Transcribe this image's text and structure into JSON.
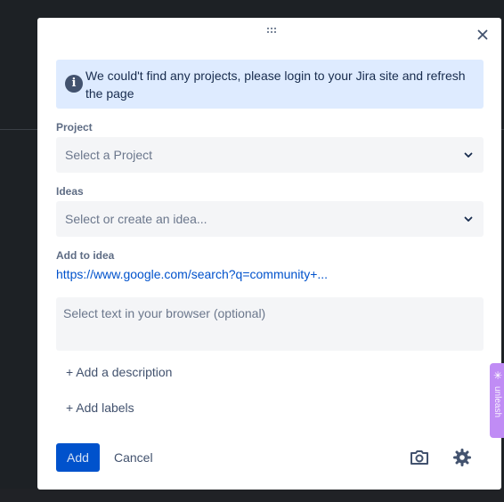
{
  "banner": {
    "icon": "info-icon",
    "text": "We could't find any projects, please login to your Jira site and refresh the page"
  },
  "fields": {
    "project": {
      "label": "Project",
      "placeholder": "Select a Project"
    },
    "ideas": {
      "label": "Ideas",
      "placeholder": "Select or create an idea..."
    },
    "add_to_idea": {
      "label": "Add to idea",
      "link": "https://www.google.com/search?q=community+..."
    },
    "selection": {
      "placeholder": "Select text in your browser (optional)"
    }
  },
  "actions": {
    "add_description": "+ Add a description",
    "add_labels": "+ Add labels"
  },
  "footer": {
    "add_label": "Add",
    "cancel_label": "Cancel",
    "screenshot_icon": "camera-icon",
    "settings_icon": "gear-icon"
  },
  "side_tab": {
    "label": "unleash"
  },
  "colors": {
    "primary": "#0052cc",
    "banner_bg": "#deebff",
    "field_bg": "#f4f5f7",
    "side_tab": "#c08cf5"
  }
}
